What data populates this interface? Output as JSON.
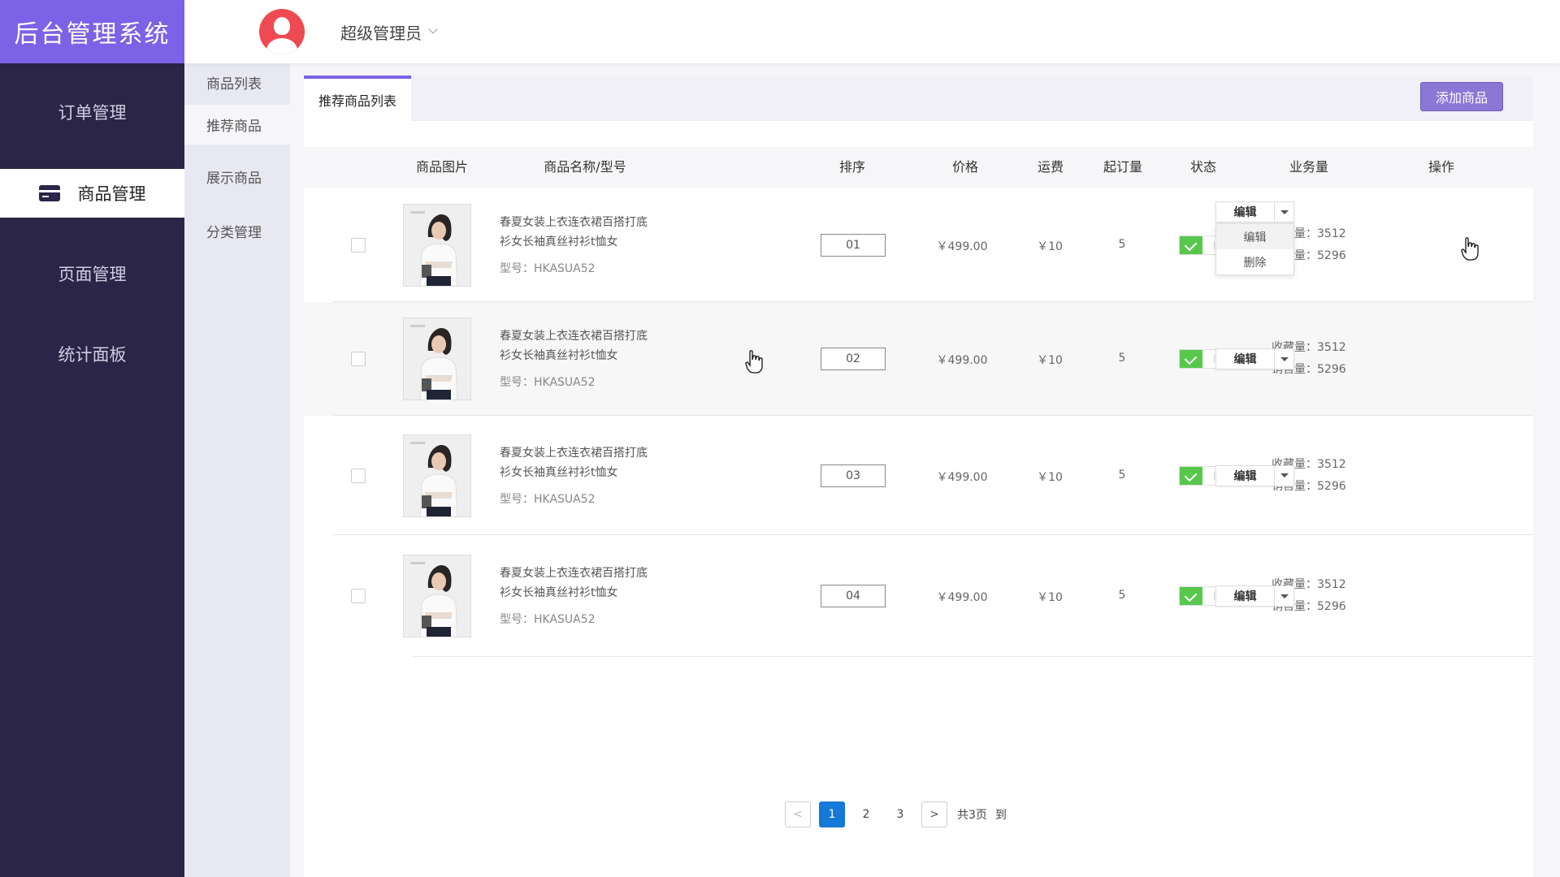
{
  "app": {
    "title": "后台管理系统"
  },
  "header": {
    "user_name": "超级管理员"
  },
  "sidebar": {
    "items": [
      {
        "label": "订单管理",
        "active": false
      },
      {
        "label": "商品管理",
        "active": true,
        "icon": "card-icon"
      },
      {
        "label": "页面管理",
        "active": false
      },
      {
        "label": "统计面板",
        "active": false
      }
    ]
  },
  "submenu": {
    "items": [
      {
        "label": "商品列表",
        "active": false
      },
      {
        "label": "推荐商品",
        "active": true
      },
      {
        "label": "展示商品",
        "active": false
      },
      {
        "label": "分类管理",
        "active": false
      }
    ]
  },
  "main": {
    "tab_label": "推荐商品列表",
    "add_button": "添加商品",
    "columns": [
      "商品图片",
      "商品名称/型号",
      "排序",
      "价格",
      "运费",
      "起订量",
      "状态",
      "业务量",
      "操作"
    ],
    "rows": [
      {
        "name_line1": "春夏女装上衣连衣裙百搭打底",
        "name_line2": "衫女长袖真丝衬衫t恤女",
        "model": "型号：HKASUA52",
        "order": "01",
        "price": "￥499.00",
        "shipping": "￥10",
        "moq": "5",
        "status_on": true,
        "favorites": "收藏量：3512",
        "sales": "销售量：5296",
        "edit": "编辑"
      },
      {
        "name_line1": "春夏女装上衣连衣裙百搭打底",
        "name_line2": "衫女长袖真丝衬衫t恤女",
        "model": "型号：HKASUA52",
        "order": "02",
        "price": "￥499.00",
        "shipping": "￥10",
        "moq": "5",
        "status_on": true,
        "favorites": "收藏量：3512",
        "sales": "销售量：5296",
        "edit": "编辑"
      },
      {
        "name_line1": "春夏女装上衣连衣裙百搭打底",
        "name_line2": "衫女长袖真丝衬衫t恤女",
        "model": "型号：HKASUA52",
        "order": "03",
        "price": "￥499.00",
        "shipping": "￥10",
        "moq": "5",
        "status_on": true,
        "favorites": "收藏量：3512",
        "sales": "销售量：5296",
        "edit": "编辑"
      },
      {
        "name_line1": "春夏女装上衣连衣裙百搭打底",
        "name_line2": "衫女长袖真丝衬衫t恤女",
        "model": "型号：HKASUA52",
        "order": "04",
        "price": "￥499.00",
        "shipping": "￥10",
        "moq": "5",
        "status_on": true,
        "favorites": "收藏量：3512",
        "sales": "销售量：5296",
        "edit": "编辑"
      }
    ],
    "dropdown_options": [
      "编辑",
      "删除"
    ]
  },
  "pagination": {
    "prev": "<",
    "pages": [
      "1",
      "2",
      "3"
    ],
    "current": "1",
    "next": ">",
    "total_text": "共3页",
    "goto_text": "到"
  },
  "colors": {
    "brand": "#7b62e6",
    "sidebar_bg": "#2b2548",
    "toggle_on": "#58c84d",
    "page_active": "#1479d7",
    "avatar": "#ef4a51"
  }
}
